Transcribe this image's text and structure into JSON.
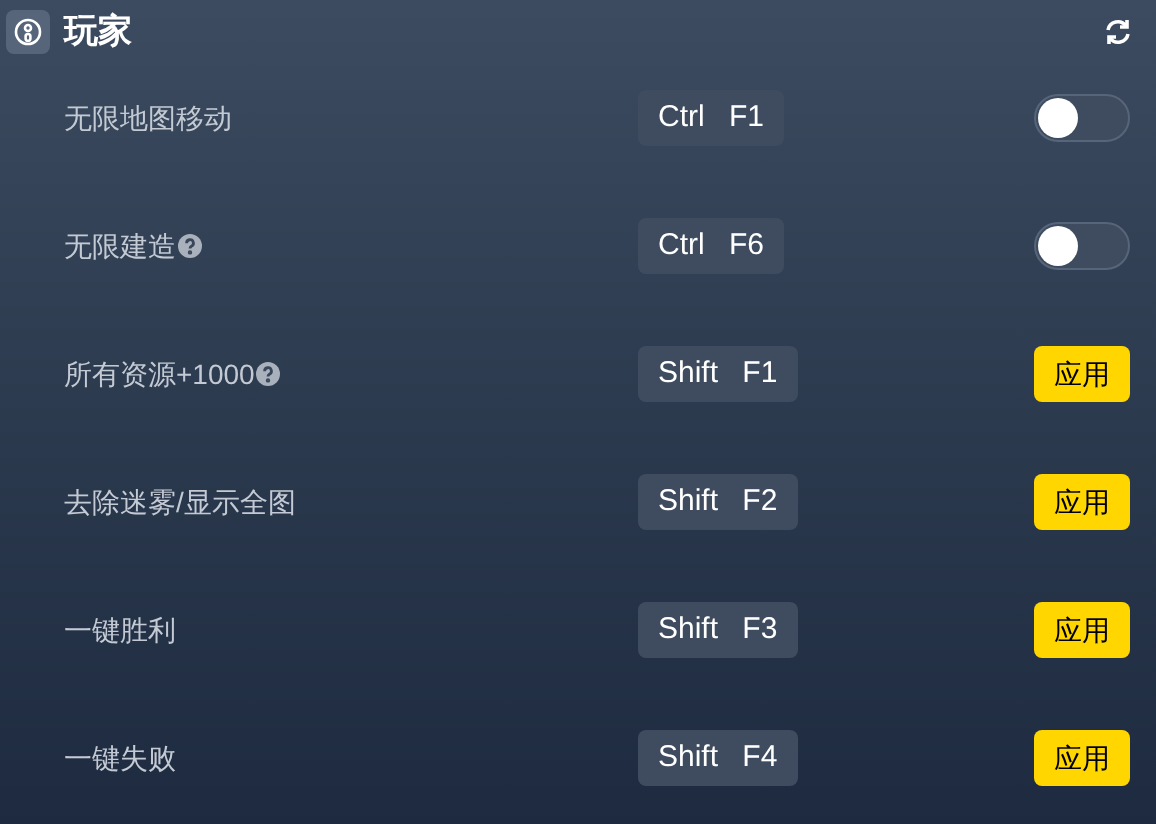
{
  "header": {
    "title": "玩家"
  },
  "rows": [
    {
      "label": "无限地图移动",
      "help": false,
      "hotkey": "Ctrl F1",
      "kind": "toggle",
      "on": false
    },
    {
      "label": "无限建造",
      "help": true,
      "hotkey": "Ctrl F6",
      "kind": "toggle",
      "on": false
    },
    {
      "label": "所有资源+1000",
      "help": true,
      "hotkey": "Shift F1",
      "kind": "button",
      "button": "应用"
    },
    {
      "label": "去除迷雾/显示全图",
      "help": false,
      "hotkey": "Shift F2",
      "kind": "button",
      "button": "应用"
    },
    {
      "label": "一键胜利",
      "help": false,
      "hotkey": "Shift F3",
      "kind": "button",
      "button": "应用"
    },
    {
      "label": "一键失败",
      "help": false,
      "hotkey": "Shift F4",
      "kind": "button",
      "button": "应用"
    }
  ]
}
